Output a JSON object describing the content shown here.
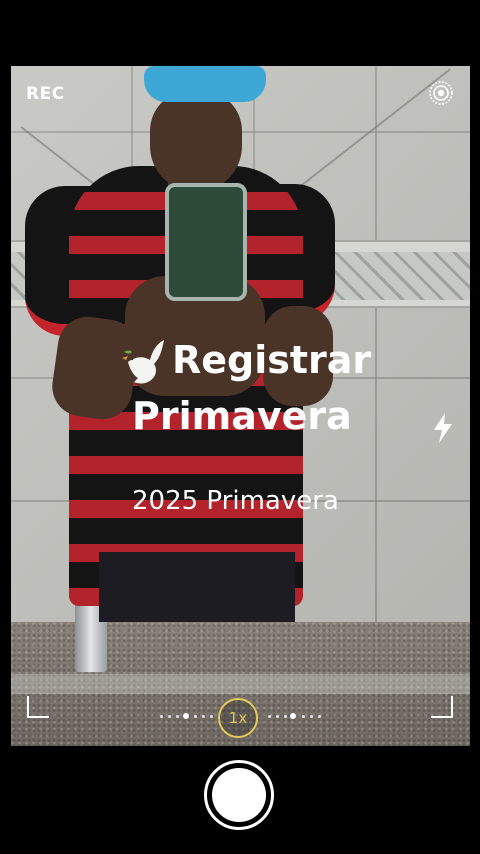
{
  "camera": {
    "rec_label": "REC",
    "top_right_icon": "live-circle-icon",
    "flash_icon": "lightning-icon",
    "zoom_label": "1x",
    "accent_color": "#e1c95a"
  },
  "overlay": {
    "icon": "dove-icon",
    "title_line1": "Registrar",
    "title_line2": "Primavera",
    "subtitle": "2025 Primavera"
  }
}
